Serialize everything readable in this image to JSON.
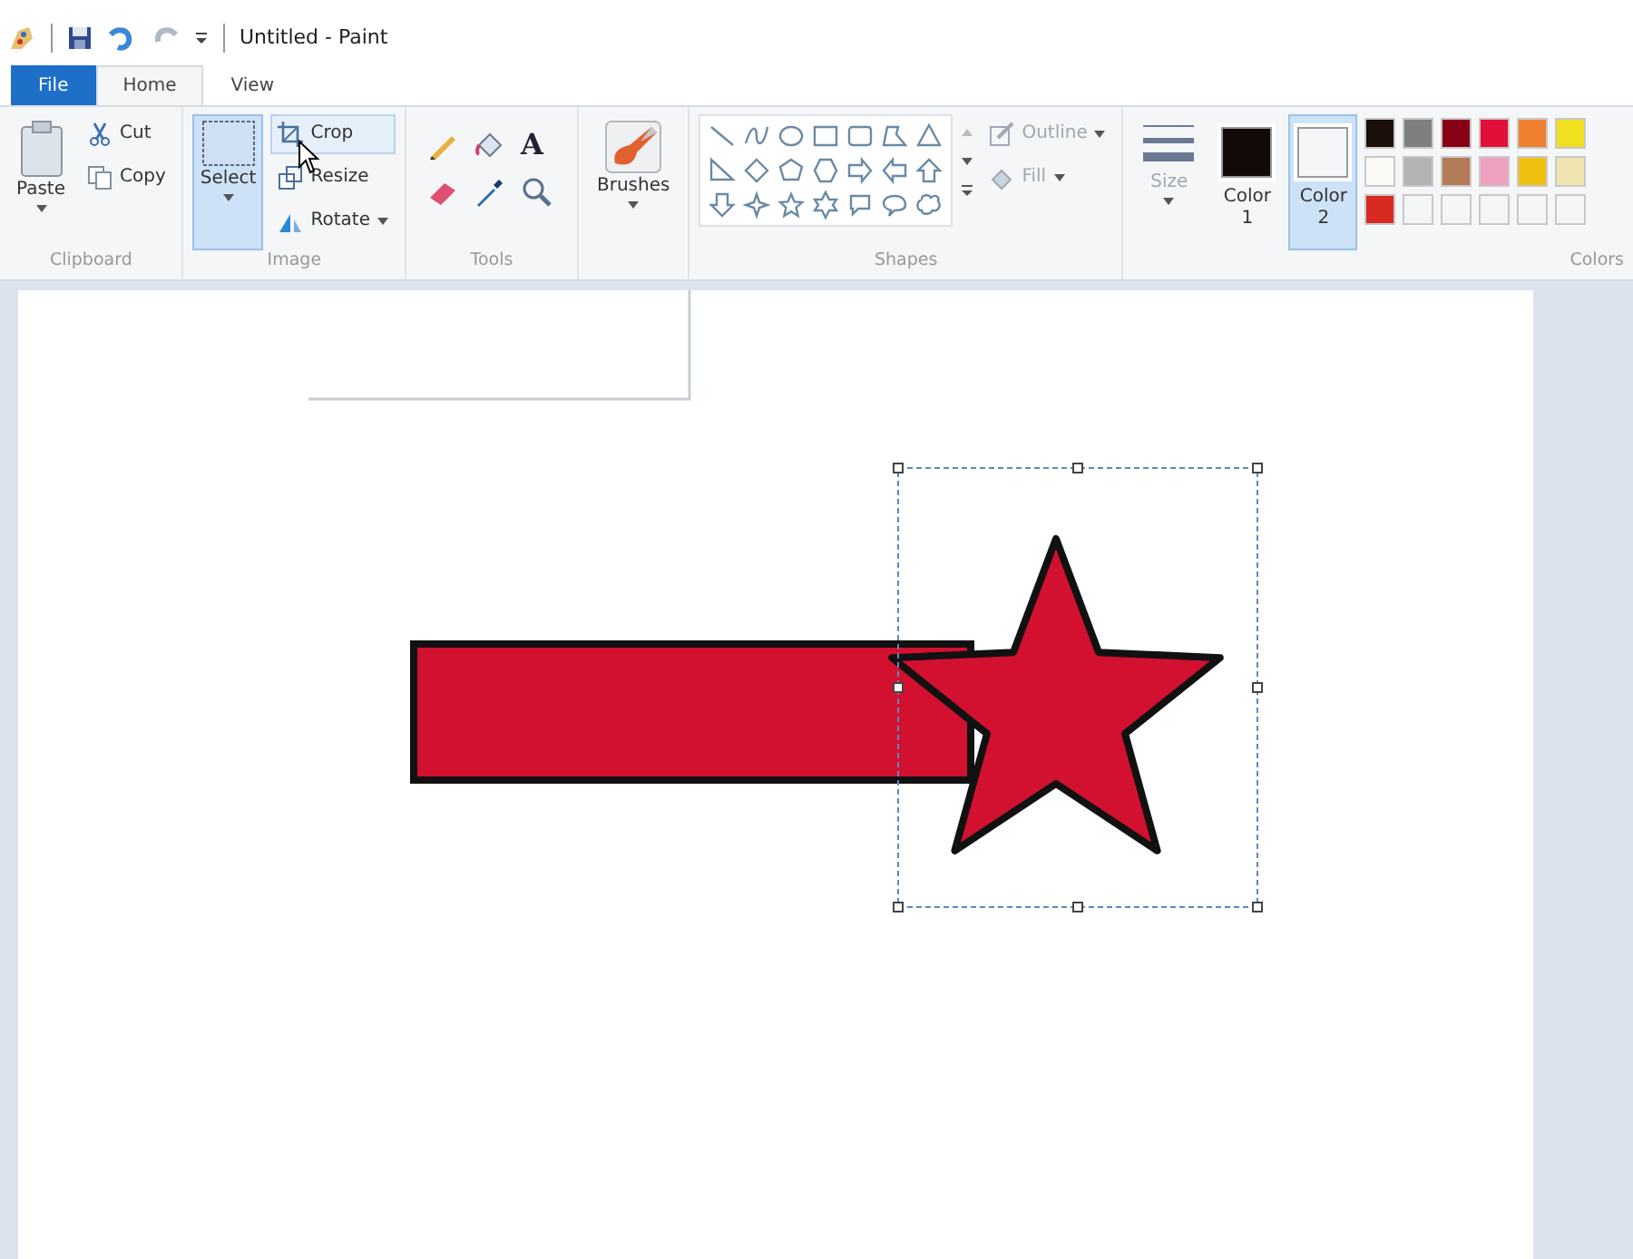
{
  "window": {
    "title": "Untitled - Paint"
  },
  "tabs": [
    {
      "label": "File",
      "kind": "app",
      "selected": false
    },
    {
      "label": "Home",
      "kind": "tab",
      "selected": true
    },
    {
      "label": "View",
      "kind": "tab",
      "selected": false
    }
  ],
  "clipboard": {
    "paste": "Paste",
    "cut": "Cut",
    "copy": "Copy",
    "label": "Clipboard"
  },
  "image": {
    "select": {
      "label": "Select",
      "selected": true
    },
    "crop": {
      "label": "Crop",
      "hovered": true
    },
    "resize": "Resize",
    "rotate": "Rotate",
    "label": "Image"
  },
  "tools": {
    "text_glyph": "A",
    "label": "Tools"
  },
  "brushes": {
    "label": "Brushes"
  },
  "shapes": {
    "outline": "Outline",
    "fill": "Fill",
    "label": "Shapes"
  },
  "size": {
    "label": "Size"
  },
  "color_slots": [
    {
      "label": "Color",
      "number": "1",
      "color": "#120a08",
      "selected": false
    },
    {
      "label": "Color",
      "number": "2",
      "color": "#f4f6f8",
      "selected": true
    }
  ],
  "palette": [
    {
      "kind": "swatch",
      "color": "#1a0f0a"
    },
    {
      "kind": "swatch",
      "color": "#7f7f7f"
    },
    {
      "kind": "swatch",
      "color": "#880015"
    },
    {
      "kind": "swatch",
      "color": "#e0103a"
    },
    {
      "kind": "swatch",
      "color": "#f08030"
    },
    {
      "kind": "swatch",
      "color": "#f0e020"
    },
    {
      "kind": "swatch",
      "color": "#fbfaf6"
    },
    {
      "kind": "swatch",
      "color": "#b4b4b4"
    },
    {
      "kind": "swatch",
      "color": "#b27a57"
    },
    {
      "kind": "swatch",
      "color": "#f0a0c0"
    },
    {
      "kind": "swatch",
      "color": "#f0c010"
    },
    {
      "kind": "swatch",
      "color": "#efe4b0"
    },
    {
      "kind": "swatch",
      "color": "#d82a20"
    },
    {
      "kind": "empty"
    },
    {
      "kind": "empty"
    },
    {
      "kind": "empty"
    },
    {
      "kind": "empty"
    },
    {
      "kind": "empty"
    }
  ],
  "colors": {
    "label": "Colors"
  },
  "canvas": {
    "selection": true
  }
}
